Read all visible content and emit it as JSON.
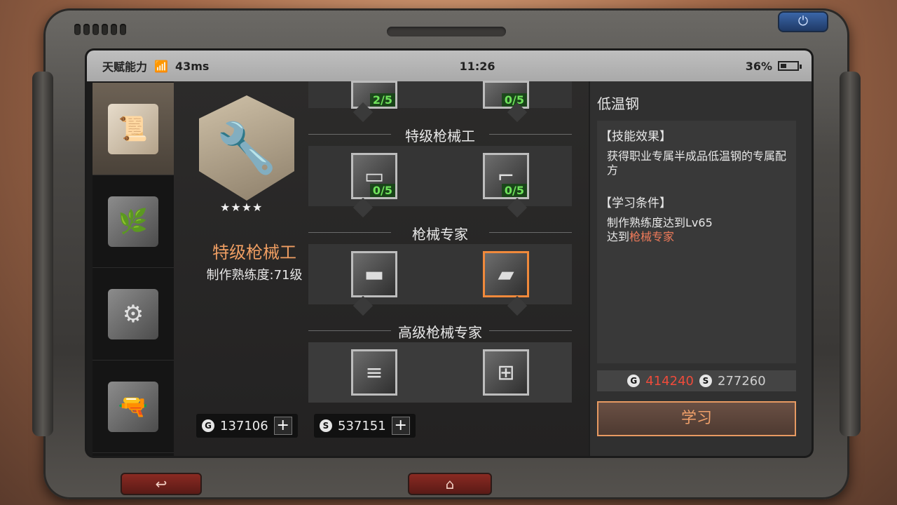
{
  "status_bar": {
    "title": "天赋能力",
    "ping": "43ms",
    "time": "11:26",
    "battery": "36%",
    "battery_level": 0.36
  },
  "sidebar": {
    "tabs": [
      {
        "name": "certificate",
        "icon": "certificate-icon",
        "active": true
      },
      {
        "name": "plant",
        "icon": "plant-icon",
        "active": false
      },
      {
        "name": "gear-wrench",
        "icon": "gear-wrench-icon",
        "active": false
      },
      {
        "name": "gun",
        "icon": "gun-icon",
        "active": false
      }
    ]
  },
  "profile": {
    "title": "特级枪械工",
    "level_text": "制作熟练度:71级",
    "stars": 4
  },
  "skill_tree": {
    "top_counts": [
      "2/5",
      "0/5"
    ],
    "tiers": [
      {
        "label": "特级枪械工",
        "skills": [
          {
            "count": "0/5"
          },
          {
            "count": "0/5"
          }
        ]
      },
      {
        "label": "枪械专家",
        "skills": [
          {
            "count": ""
          },
          {
            "count": "",
            "selected": true
          }
        ]
      },
      {
        "label": "高级枪械专家",
        "skills": [
          {
            "count": ""
          },
          {
            "count": ""
          }
        ]
      }
    ]
  },
  "currencies": {
    "gold": "137106",
    "silver": "537151",
    "gold_symbol": "G",
    "silver_symbol": "S",
    "add": "+"
  },
  "detail": {
    "title": "低温钢",
    "effect_header": "【技能效果】",
    "effect_text": "获得职业专属半成品低温钢的专属配方",
    "cond_header": "【学习条件】",
    "cond_line1": "制作熟练度达到Lv65",
    "cond_line2_prefix": "达到",
    "cond_line2_highlight": "枪械专家",
    "cost_gold": "414240",
    "cost_silver": "277260",
    "learn_label": "学习"
  },
  "nav": {
    "back": "↩",
    "home": "⌂",
    "power": "⏻"
  }
}
